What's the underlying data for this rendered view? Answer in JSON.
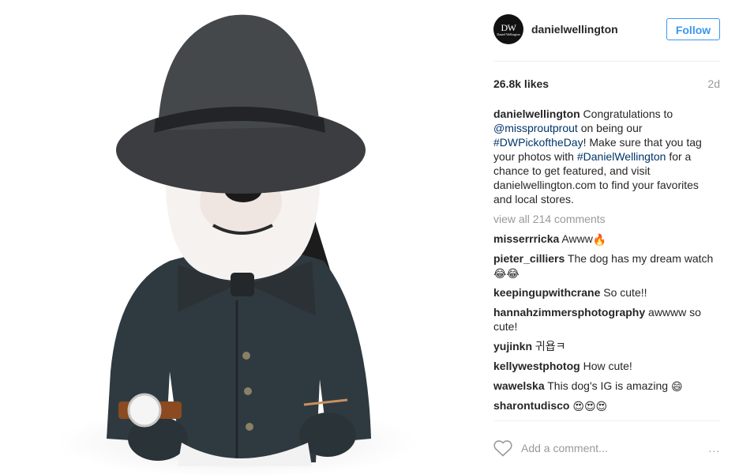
{
  "post": {
    "photo_alt": "",
    "header": {
      "avatar_monogram": "DW",
      "avatar_brand": "Daniel Wellington",
      "username": "danielwellington",
      "follow_label": "Follow"
    },
    "likes": "26.8k likes",
    "time": "2d",
    "caption": {
      "user": "danielwellington",
      "t1": " Congratulations to ",
      "mention": "@missproutprout",
      "t2": " on being our ",
      "hashtag1": "#DWPickoftheDay",
      "t3": "! Make sure that you tag your photos with ",
      "hashtag2": "#DanielWellington",
      "t4": " for a chance to get featured, and visit danielwellington.com to find your favorites and local stores."
    },
    "view_all": "view all 214 comments",
    "comments": [
      {
        "user": "misserrricka",
        "text": " Awww",
        "emoji": "🔥"
      },
      {
        "user": "pieter_cilliers",
        "text": " The dog has my dream watch",
        "emoji": "😂😂"
      },
      {
        "user": "keepingupwithcrane",
        "text": " So cute!!",
        "emoji": ""
      },
      {
        "user": "hannahzimmersphotography",
        "text": " awwww so cute!",
        "emoji": ""
      },
      {
        "user": "yujinkn",
        "text": " 귀욥ㅋ",
        "emoji": ""
      },
      {
        "user": "kellywestphotog",
        "text": " How cute!",
        "emoji": ""
      },
      {
        "user": "wawelska",
        "text": " This dog's IG is amazing ",
        "emoji": "😄"
      },
      {
        "user": "sharontudisco",
        "text": " ",
        "emoji": "😍😍😍"
      }
    ],
    "add_comment_placeholder": "Add a comment...",
    "more_label": "...",
    "colors": {
      "accent": "#3897f0",
      "link": "#003569",
      "muted": "#999999",
      "text": "#262626"
    },
    "icons": {
      "like": "heart-outline-icon",
      "more": "ellipsis-icon"
    }
  }
}
